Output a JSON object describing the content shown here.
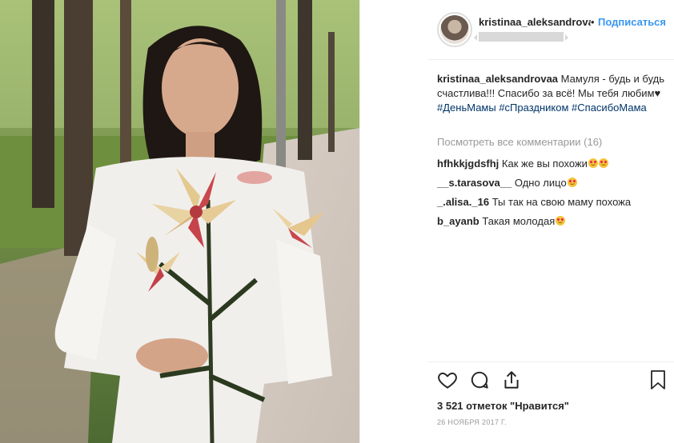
{
  "header": {
    "username": "kristinaa_aleksandrova",
    "separator": "•",
    "follow_label": "Подписаться"
  },
  "caption": {
    "username": "kristinaa_aleksandrovaa",
    "text": "Мамуля - будь и будь счастлива!!! Спасибо за всё! Мы тебя любим",
    "heart": "♥",
    "tags": [
      "#ДеньМамы",
      "#сПраздником",
      "#СпасибоМама"
    ]
  },
  "view_all_comments": "Посмотреть все комментарии (16)",
  "comments": [
    {
      "username": "hfhkkjgdsfhj",
      "text": "Как же вы похожи",
      "emoji_count": 2
    },
    {
      "username": "__s.tarasova__",
      "text": "Одно лицо",
      "emoji_count": 1
    },
    {
      "username": "_.alisa._16",
      "text": "Ты так на свою маму похожа",
      "emoji_count": 0
    },
    {
      "username": "b_ayanb",
      "text": "Такая молодая",
      "emoji_count": 1
    }
  ],
  "actions": {
    "like_icon": "heart-outline-icon",
    "comment_icon": "comment-bubble-icon",
    "share_icon": "share-icon",
    "save_icon": "bookmark-icon"
  },
  "likes_text": "3 521 отметок \"Нравится\"",
  "date_text": "26 НОЯБРЯ 2017 Г."
}
